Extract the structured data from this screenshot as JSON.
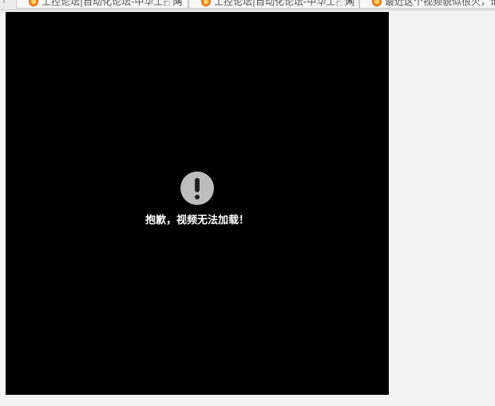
{
  "browser": {
    "tabs": [
      {
        "title": "工控论坛|自动化论坛-中华工控网",
        "close": "×"
      },
      {
        "title": "工控论坛|自动化论坛-中华工控网",
        "close": "×"
      },
      {
        "title": "最近这个视频貌似很火，谁能解释",
        "close": "×"
      }
    ],
    "scroll_left_glyph": "‹"
  },
  "video": {
    "error_message": "抱歉，视频无法加载！",
    "background_color": "#000000",
    "icon": "exclamation-circle-icon"
  }
}
